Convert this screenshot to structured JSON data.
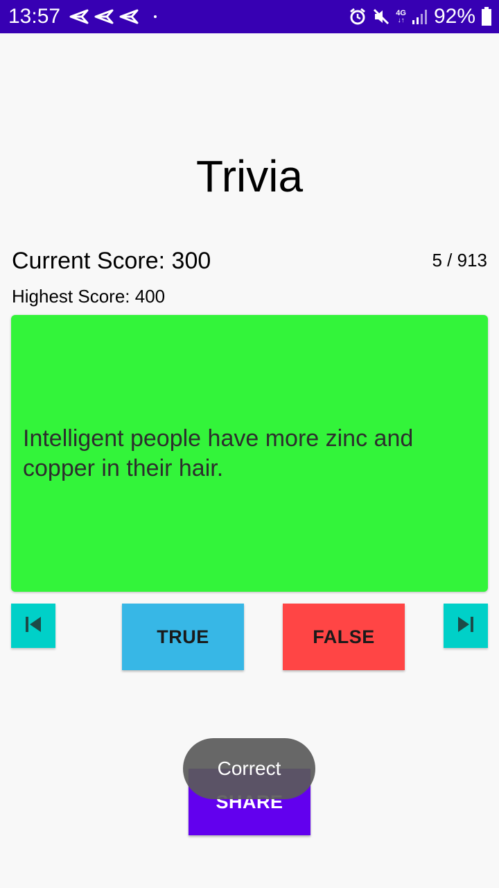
{
  "status_bar": {
    "time": "13:57",
    "left_icons": [
      "send-icon",
      "send-icon",
      "send-icon"
    ],
    "network_label": "4G",
    "network_arrows": "↓↑",
    "battery_percent": "92%",
    "right_icons": [
      "alarm-icon",
      "mute-icon",
      "signal-icon",
      "battery-icon"
    ],
    "background_color": "#3700b3"
  },
  "title": "Trivia",
  "score": {
    "current": "Current Score: 300",
    "highest": "Highest Score: 400",
    "question_count": "5 / 913"
  },
  "question": {
    "text": "Intelligent people have more zinc and copper in their hair.",
    "card_color": "#33f43a"
  },
  "buttons": {
    "true_label": "TRUE",
    "false_label": "FALSE",
    "share_label": "SHARE",
    "prev_icon": "skip-previous-icon",
    "next_icon": "skip-next-icon",
    "true_color": "#37b7e6",
    "false_color": "#ff4545",
    "nav_color": "#00d0c8",
    "share_color": "#6200ee"
  },
  "toast": {
    "message": "Correct"
  }
}
